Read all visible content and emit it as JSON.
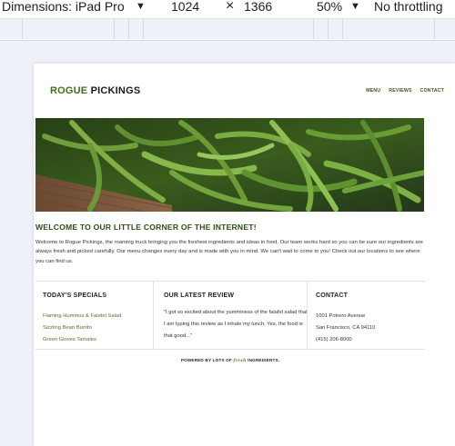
{
  "devtools": {
    "device_label": "Dimensions: iPad Pro",
    "width_value": "1024",
    "height_value": "1366",
    "zoom_value": "50%",
    "throttle_value": "No throttling",
    "dropdown_icon": "chevron-down-icon",
    "swap_icon": "x-icon"
  },
  "site": {
    "logo_word1": "ROGUE",
    "logo_word2": " PICKINGS",
    "nav": [
      "MENU",
      "REVIEWS",
      "CONTACT"
    ],
    "hero_image": "green-beans-photo",
    "welcome_heading": "WELCOME TO OUR LITTLE CORNER OF THE INTERNET!",
    "intro_text": "Welcome to Rogue Pickings, the roaming truck bringing you the freshest ingredients and ideas in food. Our team works hard so you can be sure our ingredients are always fresh and picked carefully. Our menu changes every day and is made with you in mind. We can't wait to come to you! Check out our locations to see where you can find us.",
    "specials": {
      "title": "TODAY'S SPECIALS",
      "items": [
        "Flaming Hummus & Falafel Salad",
        "Sizzling Bean Burrito",
        "Green Gloves Tamales"
      ]
    },
    "review": {
      "title": "OUR LATEST REVIEW",
      "text": "\"I got so excited about the yumminess of the falafel salad that I am typing this review as I inhale my lunch. Yes, the food is that good...\""
    },
    "contact": {
      "title": "CONTACT",
      "lines": [
        "1001 Potrero Avenue",
        "San Francisco, CA 94110",
        "(415) 206-8000"
      ]
    },
    "footer": {
      "prefix": "POWERED BY LOTS OF ",
      "fresh": "fresh",
      "suffix": " INGREDIENTS."
    }
  },
  "colors": {
    "brand_green": "#3f6f1c",
    "heading_green": "#2d4d12",
    "special_text": "#5a6d2e"
  }
}
